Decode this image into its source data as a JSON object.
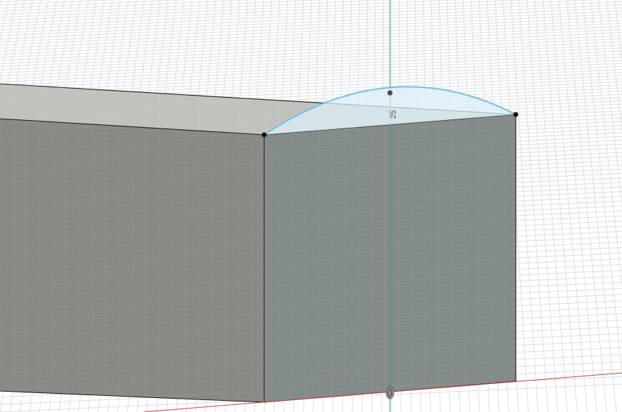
{
  "viewport": {
    "background_color": "#ffffff",
    "grid_color": "#d4d8dc",
    "x_axis_color": "#d63a3a",
    "z_axis_color": "#2ea84a"
  },
  "model": {
    "top_face_color": "#c2c2bd",
    "left_face_color": "#8a8a84",
    "right_face_color": "#848b8b",
    "edge_color": "#1a1a1a"
  },
  "sketch": {
    "arc_color": "#6cbfe8",
    "arc_fill_color": "#dcedf8",
    "dimension_value": "25"
  },
  "origin": {
    "icon": "origin-point-icon"
  }
}
